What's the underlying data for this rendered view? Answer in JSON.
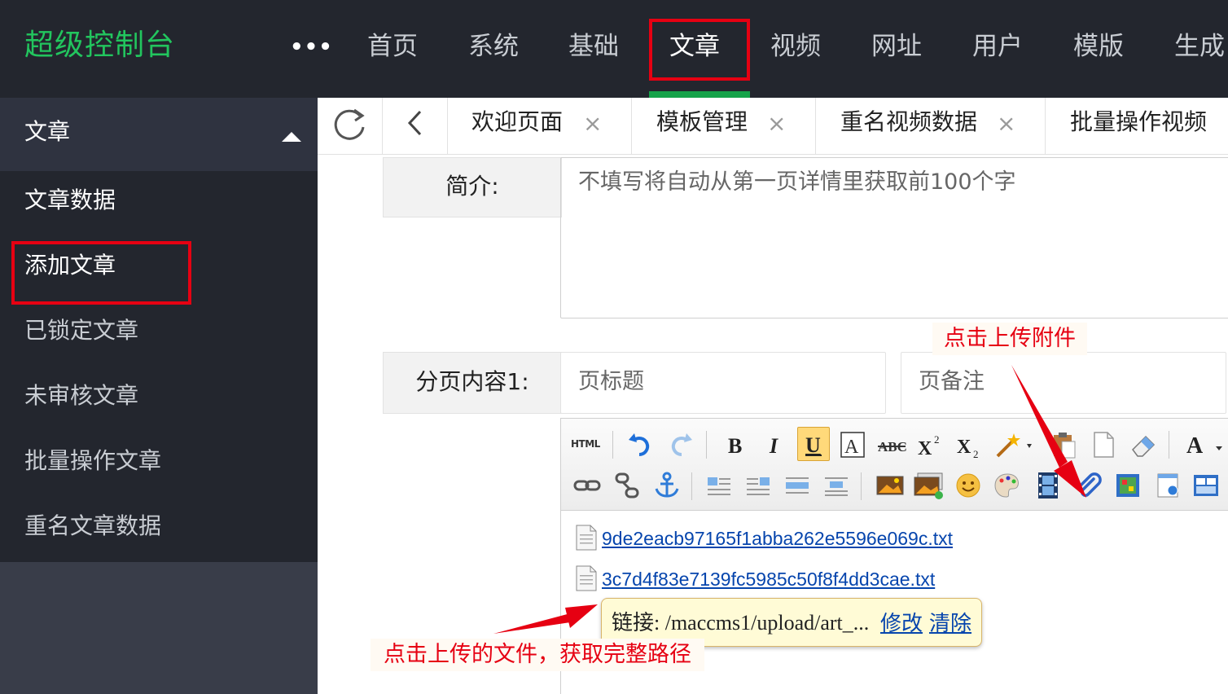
{
  "app": {
    "title": "超级控制台",
    "more": "•••"
  },
  "topnav": [
    "首页",
    "系统",
    "基础",
    "文章",
    "视频",
    "网址",
    "用户",
    "模版",
    "生成"
  ],
  "sidebar": {
    "section": "文章",
    "items": [
      "文章数据",
      "添加文章",
      "已锁定文章",
      "未审核文章",
      "批量操作文章",
      "重名文章数据"
    ]
  },
  "tabs": [
    {
      "label": "欢迎页面",
      "close": "×"
    },
    {
      "label": "模板管理",
      "close": "×"
    },
    {
      "label": "重名视频数据",
      "close": "×"
    },
    {
      "label": "批量操作视频",
      "close": "×"
    }
  ],
  "form": {
    "intro_label": "简介:",
    "intro_placeholder": "不填写将自动从第一页详情里获取前100个字",
    "page_content_label": "分页内容1:",
    "page_title_placeholder": "页标题",
    "page_note_placeholder": "页备注"
  },
  "editor": {
    "html_button": "HTML",
    "files": [
      "9de2eacb97165f1abba262e5596e069c.txt",
      "3c7d4f83e7139fc5985c50f8f4dd3cae.txt"
    ],
    "link_popup": {
      "label": "链接:",
      "path": "/maccms1/upload/art_...",
      "edit": "修改",
      "clear": "清除"
    }
  },
  "annotations": {
    "upload_hint": "点击上传附件",
    "path_hint": "点击上传的文件，获取完整路径"
  },
  "colors": {
    "topbar": "#23262e",
    "sidebar": "#393d49",
    "logo": "#22c55e",
    "accent": "#16a34a",
    "highlight": "#e60012"
  }
}
